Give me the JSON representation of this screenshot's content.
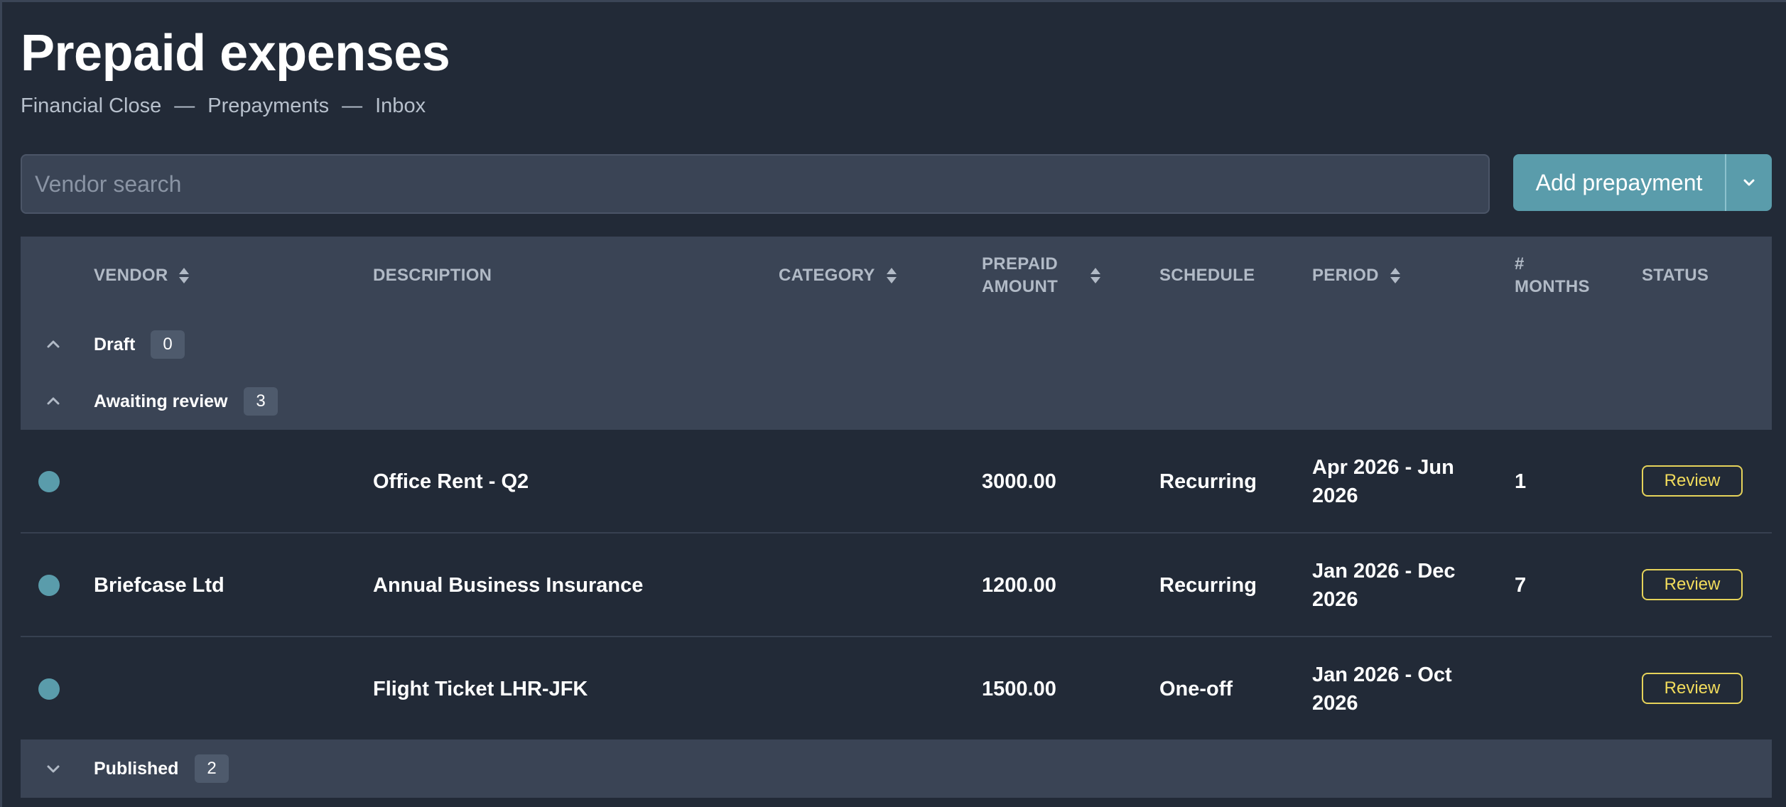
{
  "page": {
    "title": "Prepaid expenses",
    "breadcrumb": [
      "Financial Close",
      "Prepayments",
      "Inbox"
    ],
    "breadcrumb_separator": "—"
  },
  "search": {
    "placeholder": "Vendor search",
    "value": ""
  },
  "add_button": {
    "label": "Add prepayment",
    "dropdown_icon": "chevron-down-icon"
  },
  "columns": {
    "vendor": "VENDOR",
    "description": "DESCRIPTION",
    "category": "CATEGORY",
    "prepaid_amount_line1": "PREPAID",
    "prepaid_amount_line2": "AMOUNT",
    "schedule": "SCHEDULE",
    "period": "PERIOD",
    "months_line1": "#",
    "months_line2": "MONTHS",
    "status": "STATUS"
  },
  "groups": {
    "draft": {
      "label": "Draft",
      "count": "0",
      "expanded": true
    },
    "awaiting": {
      "label": "Awaiting review",
      "count": "3",
      "expanded": true
    },
    "published": {
      "label": "Published",
      "count": "2",
      "expanded": false
    }
  },
  "rows": [
    {
      "vendor": "",
      "description": "Office Rent - Q2",
      "category": "",
      "amount": "3000.00",
      "schedule": "Recurring",
      "period_line1": "Apr 2026 - Jun",
      "period_line2": "2026",
      "months": "1",
      "status": "Review"
    },
    {
      "vendor": "Briefcase Ltd",
      "description": "Annual Business Insurance",
      "category": "",
      "amount": "1200.00",
      "schedule": "Recurring",
      "period_line1": "Jan 2026 - Dec",
      "period_line2": "2026",
      "months": "7",
      "status": "Review"
    },
    {
      "vendor": "",
      "description": "Flight Ticket LHR-JFK",
      "category": "",
      "amount": "1500.00",
      "schedule": "One-off",
      "period_line1": "Jan 2026 - Oct",
      "period_line2": "2026",
      "months": "",
      "status": "Review"
    }
  ],
  "colors": {
    "background": "#222a37",
    "header_background": "#3a4455",
    "accent": "#5a9cab",
    "review_border": "#e6d35a",
    "header_text": "#b1bac6"
  }
}
